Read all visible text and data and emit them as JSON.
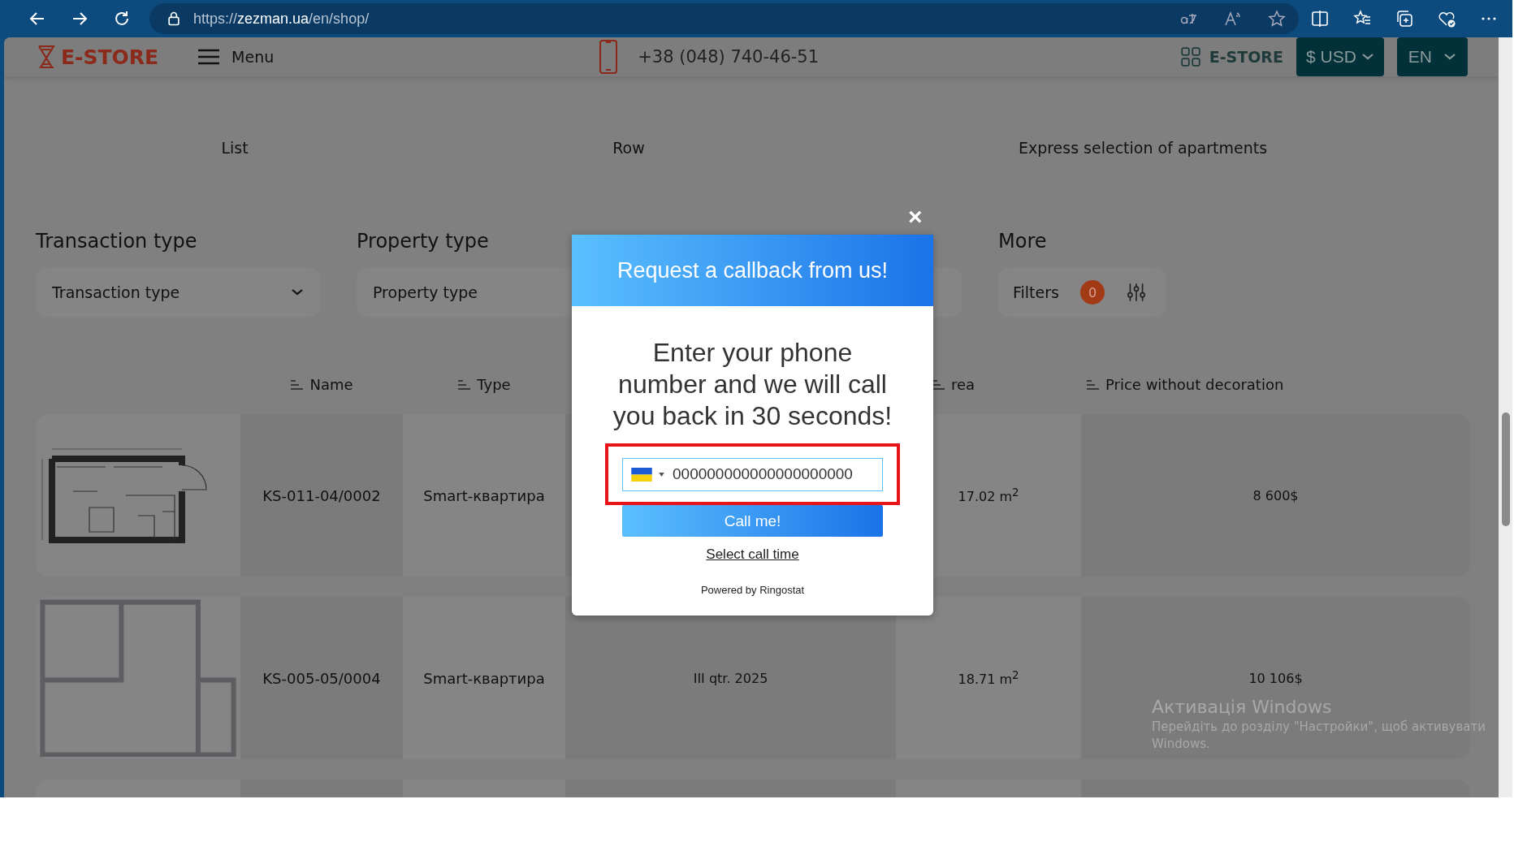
{
  "browser": {
    "url": "https://**zezman.ua**/en/shop/"
  },
  "header": {
    "logo": "E-STORE",
    "menu": "Menu",
    "phone": "+38 (048) 740-46-51",
    "store_link": "E-STORE",
    "currency": "$ USD",
    "language": "EN"
  },
  "view_tabs": [
    "List",
    "Row",
    "Express selection of apartments"
  ],
  "filters": [
    {
      "kind": "dropdown",
      "label": "Transaction type",
      "value": "Transaction type"
    },
    {
      "kind": "dropdown",
      "label": "Property type",
      "value": "Property type"
    },
    {
      "kind": "covered"
    },
    {
      "kind": "more",
      "label": "More",
      "button": "Filters",
      "count": "0"
    }
  ],
  "columns": [
    {
      "kind": "name",
      "label": "Name"
    },
    {
      "kind": "type",
      "label": "Type"
    },
    {
      "kind": "area",
      "label": "rea"
    },
    {
      "kind": "price",
      "label": "Price without decoration"
    }
  ],
  "rows": [
    {
      "kind": "studio",
      "name": "KS-011-04/0002",
      "type": "Smart-квартира",
      "area": "17.02 m$^{2}$",
      "price": "8 600$"
    },
    {
      "kind": "blocks",
      "name": "KS-005-05/0004",
      "type": "Smart-квартира",
      "date": "III qtr. 2025",
      "area": "18.71 m$^{2}$",
      "price": "10 106$"
    },
    {
      "kind": "empty"
    }
  ],
  "callback": {
    "close": "×",
    "title": "Request a callback from us!",
    "message": "Enter your phone number and we will call you back in 30 seconds!",
    "phone": "000000000000000000000",
    "button": "Call me!",
    "link": "Select call time",
    "powered": "Powered by Ringostat"
  },
  "os_notice": {
    "title": "Активація Windows",
    "text": "Перейдіть до розділу \"Настройки\", щоб активувати Windows."
  }
}
